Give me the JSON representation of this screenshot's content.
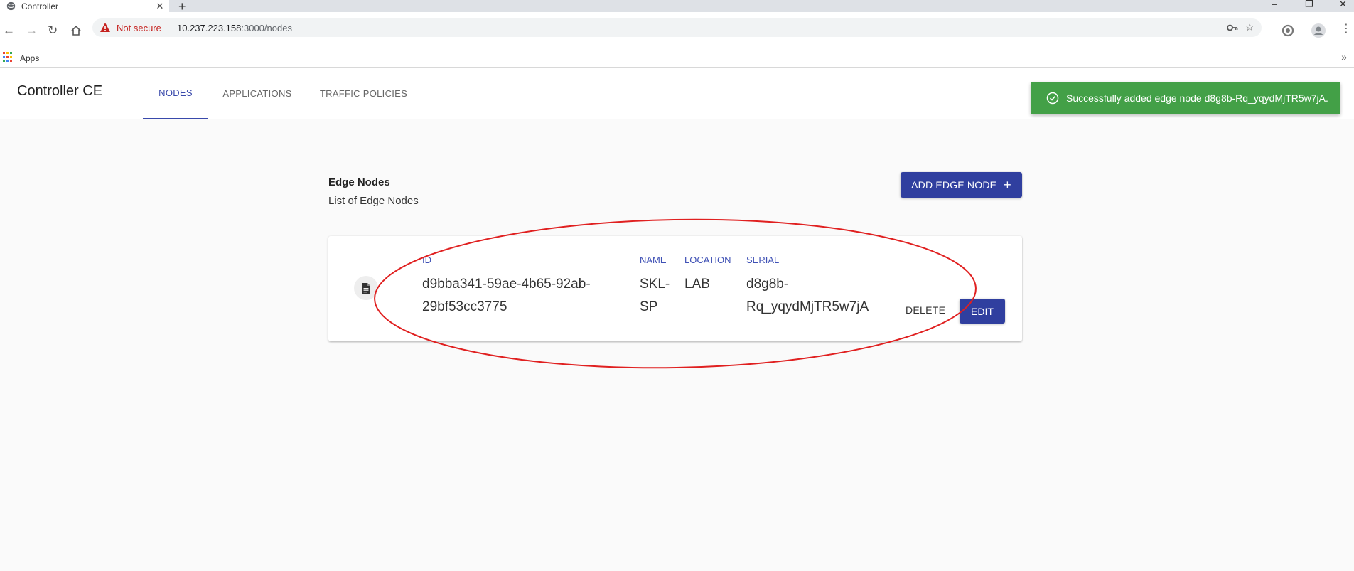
{
  "browser": {
    "tab_title": "Controller",
    "tab_close": "✕",
    "new_tab": "+",
    "security_label": "Not secure",
    "url_host": "10.237.223.158",
    "url_rest": ":3000/nodes",
    "bookmarks": {
      "apps_label": "Apps",
      "more": "»"
    },
    "window_controls": {
      "minimize": "–",
      "restore": "❐",
      "close": "✕"
    }
  },
  "app": {
    "brand": "Controller CE",
    "nav": [
      {
        "label": "NODES",
        "active": true
      },
      {
        "label": "APPLICATIONS",
        "active": false
      },
      {
        "label": "TRAFFIC POLICIES",
        "active": false
      }
    ]
  },
  "toast": {
    "message": "Successfully added edge node d8g8b-Rq_yqydMjTR5w7jA.",
    "color": "#43a047"
  },
  "section": {
    "title": "Edge Nodes",
    "subtitle": "List of Edge Nodes",
    "add_button": "ADD EDGE NODE",
    "add_icon": "+"
  },
  "node": {
    "headers": {
      "id": "ID",
      "name": "NAME",
      "location": "LOCATION",
      "serial": "SERIAL"
    },
    "id_line1": "d9bba341-59ae-4b65-92ab-",
    "id_line2": "29bf53cc3775",
    "name_line1": "SKL-",
    "name_line2": "SP",
    "location": "LAB",
    "serial_line1": "d8g8b-",
    "serial_line2": "Rq_yqydMjTR5w7jA",
    "delete_label": "DELETE",
    "edit_label": "EDIT"
  },
  "colors": {
    "primary": "#303f9f",
    "nav_active": "#3949ab",
    "annotation": "#e02020"
  }
}
